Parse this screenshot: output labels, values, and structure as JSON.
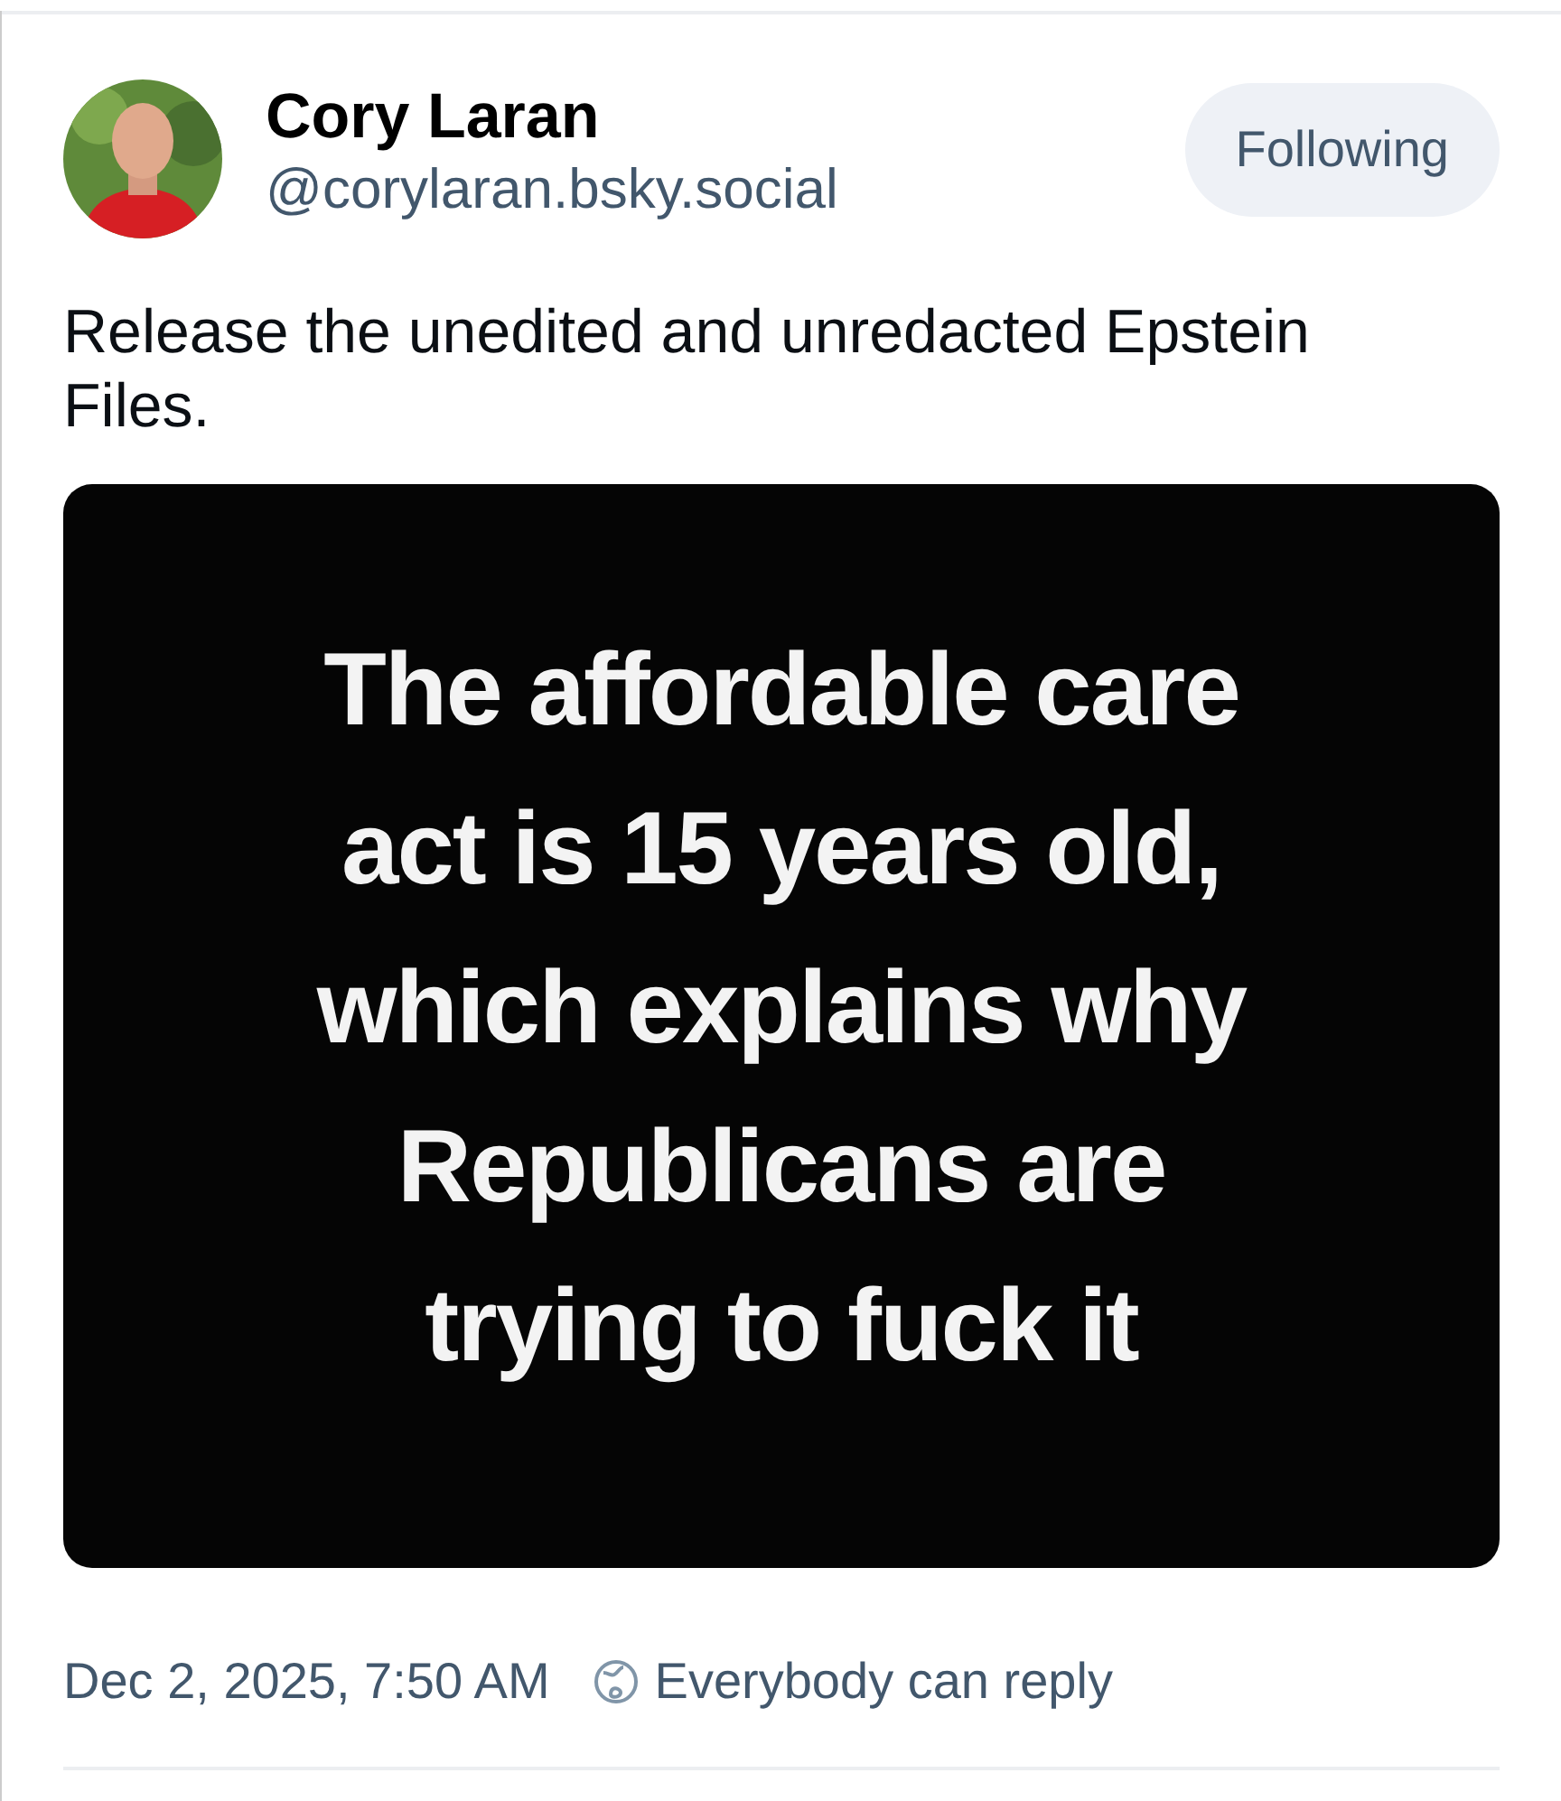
{
  "author": {
    "name": "Cory Laran",
    "handle": "@corylaran.bsky.social"
  },
  "follow_button": {
    "label": "Following"
  },
  "post_text": "Release the unedited and unredacted Epstein Files.",
  "image": {
    "lines": [
      "The affordable care",
      "act is 15 years old,",
      "which explains why",
      "Republicans are",
      "trying to fuck it"
    ]
  },
  "footer": {
    "timestamp": "Dec 2, 2025, 7:50 AM",
    "reply_setting": "Everybody can reply"
  }
}
